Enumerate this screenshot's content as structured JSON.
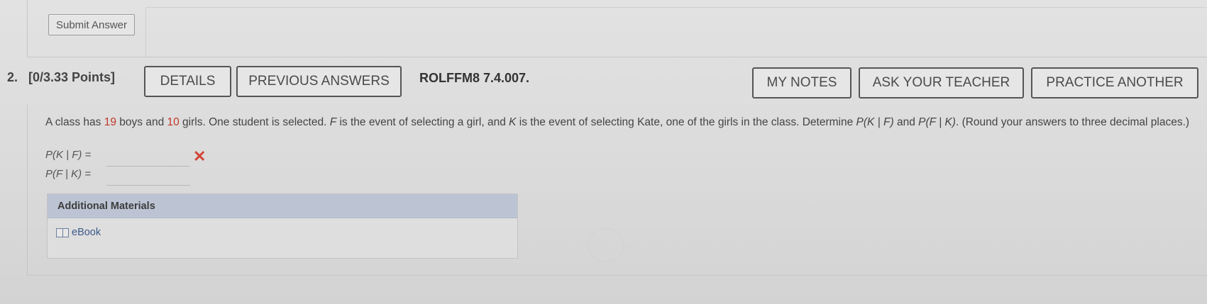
{
  "previous_question": {
    "submit_label": "Submit Answer"
  },
  "question": {
    "number": "2.",
    "points": "[0/3.33 Points]",
    "code": "ROLFFM8 7.4.007.",
    "buttons": {
      "details": "DETAILS",
      "previous_answers": "PREVIOUS ANSWERS",
      "my_notes": "MY NOTES",
      "ask_teacher": "ASK YOUR TEACHER",
      "practice": "PRACTICE ANOTHER"
    },
    "text": {
      "part1": "A class has ",
      "boys": "19",
      "part2": " boys and ",
      "girls": "10",
      "part3": " girls. One student is selected. ",
      "F": "F",
      "part4": " is the event of selecting a girl, and ",
      "K": "K",
      "part5": " is the event of selecting Kate, one of the girls in the class. Determine ",
      "pkf": "P(K | F)",
      "and": " and ",
      "pfk": "P(F | K)",
      "part6": ". (Round your answers to three decimal places.)"
    },
    "answers": [
      {
        "label": "P(K | F) =",
        "value": "",
        "status": "incorrect"
      },
      {
        "label": "P(F | K) =",
        "value": ""
      }
    ],
    "wrong_mark": "✕",
    "materials": {
      "heading": "Additional Materials",
      "items": [
        {
          "label": "eBook",
          "icon": "book-icon"
        }
      ]
    }
  }
}
